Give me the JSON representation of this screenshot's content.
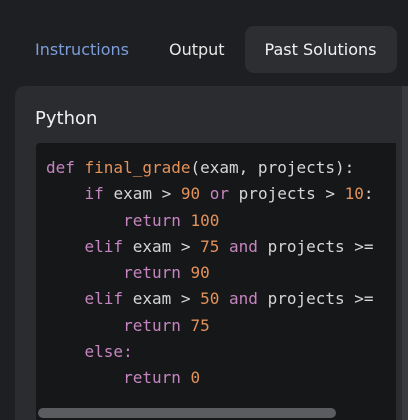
{
  "tabs": [
    {
      "label": "Instructions",
      "active": false
    },
    {
      "label": "Output",
      "active": false
    },
    {
      "label": "Past Solutions",
      "active": true
    }
  ],
  "panel": {
    "language": "Python",
    "code_lines": [
      [
        {
          "t": "def ",
          "c": "kw"
        },
        {
          "t": "final_grade",
          "c": "fn"
        },
        {
          "t": "(exam, projects):",
          "c": "name"
        }
      ],
      [
        {
          "t": "    if ",
          "c": "kw"
        },
        {
          "t": "exam > ",
          "c": "name"
        },
        {
          "t": "90",
          "c": "num"
        },
        {
          "t": " or ",
          "c": "kw"
        },
        {
          "t": "projects > ",
          "c": "name"
        },
        {
          "t": "10",
          "c": "num"
        },
        {
          "t": ":",
          "c": "name"
        }
      ],
      [
        {
          "t": "        return ",
          "c": "kw"
        },
        {
          "t": "100",
          "c": "num"
        }
      ],
      [
        {
          "t": "    elif ",
          "c": "kw"
        },
        {
          "t": "exam > ",
          "c": "name"
        },
        {
          "t": "75",
          "c": "num"
        },
        {
          "t": " and ",
          "c": "kw"
        },
        {
          "t": "projects >=",
          "c": "name"
        }
      ],
      [
        {
          "t": "        return ",
          "c": "kw"
        },
        {
          "t": "90",
          "c": "num"
        }
      ],
      [
        {
          "t": "    elif ",
          "c": "kw"
        },
        {
          "t": "exam > ",
          "c": "name"
        },
        {
          "t": "50",
          "c": "num"
        },
        {
          "t": " and ",
          "c": "kw"
        },
        {
          "t": "projects >=",
          "c": "name"
        }
      ],
      [
        {
          "t": "        return ",
          "c": "kw"
        },
        {
          "t": "75",
          "c": "num"
        }
      ],
      [
        {
          "t": "    else:",
          "c": "kw"
        }
      ],
      [
        {
          "t": "        return ",
          "c": "kw"
        },
        {
          "t": "0",
          "c": "num"
        }
      ]
    ]
  },
  "colors": {
    "background": "#1e1f22",
    "panel": "#2a2c30",
    "code_bg": "#161719",
    "tab_link": "#7c9dd9",
    "keyword": "#c586c0",
    "number": "#e2925a"
  }
}
